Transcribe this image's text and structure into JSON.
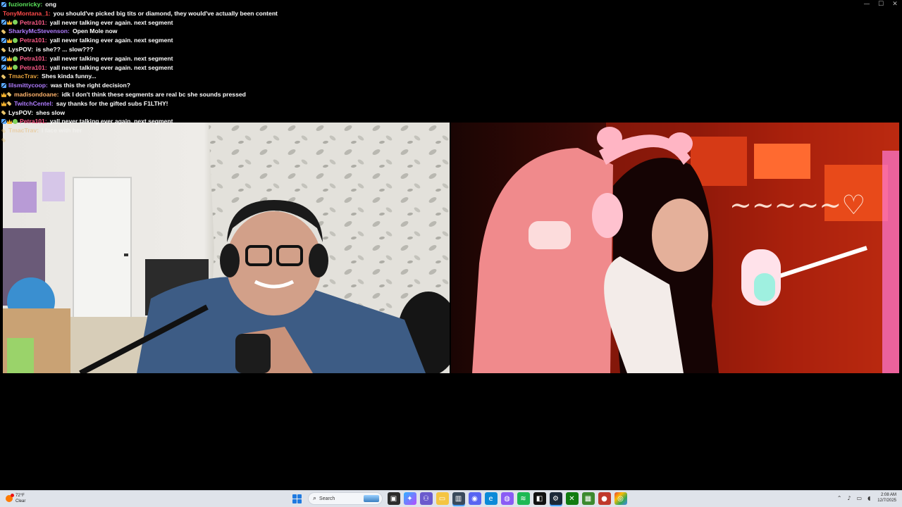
{
  "chat": [
    {
      "user": "fuzionricky",
      "color": "#5ce65c",
      "badges": [
        "sword"
      ],
      "text": "ong"
    },
    {
      "user": "TonyMontana_1",
      "color": "#ff4a4a",
      "badges": [],
      "text": "you should've picked big tits or diamond, they would've actually been content"
    },
    {
      "user": "Petra101",
      "color": "#ff5c8a",
      "badges": [
        "sword",
        "crown",
        "gift"
      ],
      "text": "yall never talking ever again. next segment"
    },
    {
      "user": "SharkyMcStevenson",
      "color": "#b07cff",
      "badges": [
        "pencil"
      ],
      "text": "Open Mole now"
    },
    {
      "user": "Petra101",
      "color": "#ff5c8a",
      "badges": [
        "sword",
        "crown",
        "gift"
      ],
      "text": "yall never talking ever again. next segment"
    },
    {
      "user": "LysPOV",
      "color": "#ffffff",
      "badges": [
        "pencil"
      ],
      "text": "is she?? ... slow???"
    },
    {
      "user": "Petra101",
      "color": "#ff5c8a",
      "badges": [
        "sword",
        "crown",
        "gift"
      ],
      "text": "yall never talking ever again. next segment"
    },
    {
      "user": "Petra101",
      "color": "#ff5c8a",
      "badges": [
        "sword",
        "crown",
        "gift"
      ],
      "text": "yall never talking ever again. next segment"
    },
    {
      "user": "TmacTrav",
      "color": "#e8a33c",
      "badges": [
        "pencil"
      ],
      "text": "Shes kinda funny..."
    },
    {
      "user": "lilsmittycoop",
      "color": "#b07cff",
      "badges": [
        "sword"
      ],
      "text": "was this the right decision?"
    },
    {
      "user": "madisondoane",
      "color": "#ffb36b",
      "badges": [
        "crown",
        "pencil"
      ],
      "text": "idk I don't think these segments are real bc she sounds pressed"
    },
    {
      "user": "TwitchCentel",
      "color": "#b07cff",
      "badges": [
        "crown",
        "pencil"
      ],
      "text": "say thanks for the gifted subs F1LTHY!"
    },
    {
      "user": "LysPOV",
      "color": "#ffffff",
      "badges": [
        "pencil"
      ],
      "text": "shes slow"
    },
    {
      "user": "Petra101",
      "color": "#ff5c8a",
      "badges": [
        "sword",
        "crown",
        "gift"
      ],
      "text": "yall never talking ever again. next segment"
    },
    {
      "user": "TmacTrav",
      "color": "#e8a33c",
      "badges": [
        "pencil"
      ],
      "text": "I face with her",
      "faded": true
    },
    {
      "user": "",
      "color": "#5ce65c",
      "badges": [
        "pencil"
      ],
      "text": "",
      "faded": true
    }
  ],
  "taskbar": {
    "weather_temp": "72°F",
    "weather_desc": "Clear",
    "search_placeholder": "Search",
    "time": "2:08 AM",
    "date": "12/7/2025"
  },
  "window_controls": {
    "minimize": "—",
    "maximize": "☐",
    "close": "✕"
  }
}
